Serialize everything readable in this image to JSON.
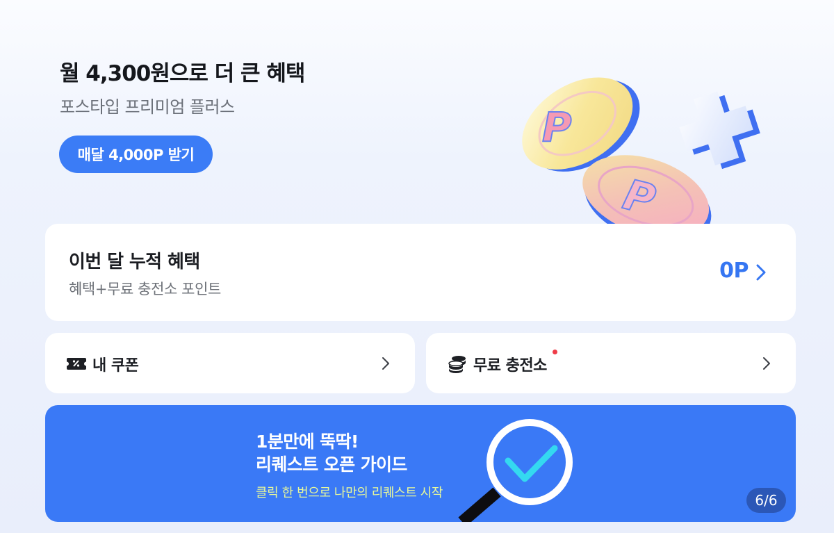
{
  "hero": {
    "title": "월 4,300원으로 더 큰 혜택",
    "subtitle": "포스타입 프리미엄 플러스",
    "cta": "매달 4,000P 받기",
    "coin_letter": "P"
  },
  "benefit": {
    "title": "이번 달 누적 혜택",
    "subtitle": "혜택+무료 충전소 포인트",
    "points": "0P"
  },
  "coupon": {
    "label": "내 쿠폰",
    "icon": "coupon-ticket-icon"
  },
  "charge": {
    "label": "무료 충전소",
    "icon": "coin-stack-icon",
    "has_new": true
  },
  "banner": {
    "line1": "1분만에 뚝딱!",
    "line2": "리퀘스트 오픈 가이드",
    "caption": "클릭 한 번으로 나만의 리퀘스트 시작",
    "page": "6/6"
  },
  "colors": {
    "accent": "#3B7CF6",
    "banner_bg": "#3A79F6",
    "caption": "#E8F89A",
    "new_dot": "#EF3B47"
  }
}
